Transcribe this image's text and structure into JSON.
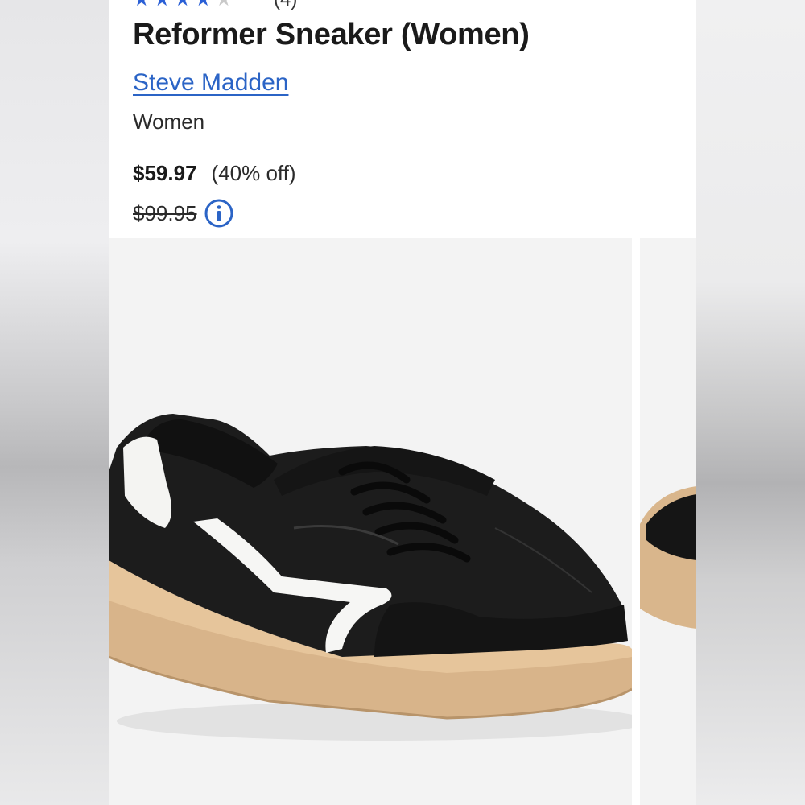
{
  "product": {
    "title": "Reformer Sneaker (Women)",
    "brand": "Steve Madden",
    "category": "Women",
    "price": "$59.97",
    "discount": "(40% off)",
    "original_price": "$99.95",
    "rating_stars": [
      "star-full",
      "star-full",
      "star-full",
      "star-half",
      "star-empty"
    ],
    "rating_count": "(4)"
  },
  "colors": {
    "brand_link": "#2b64c6",
    "star": "#2a5fd6",
    "info_icon": "#2b64c6",
    "text": "#1a1a1a"
  },
  "gallery": {
    "images": [
      "black-white-leather-sneaker-gum-sole",
      "sneaker-partial-next-image"
    ]
  }
}
